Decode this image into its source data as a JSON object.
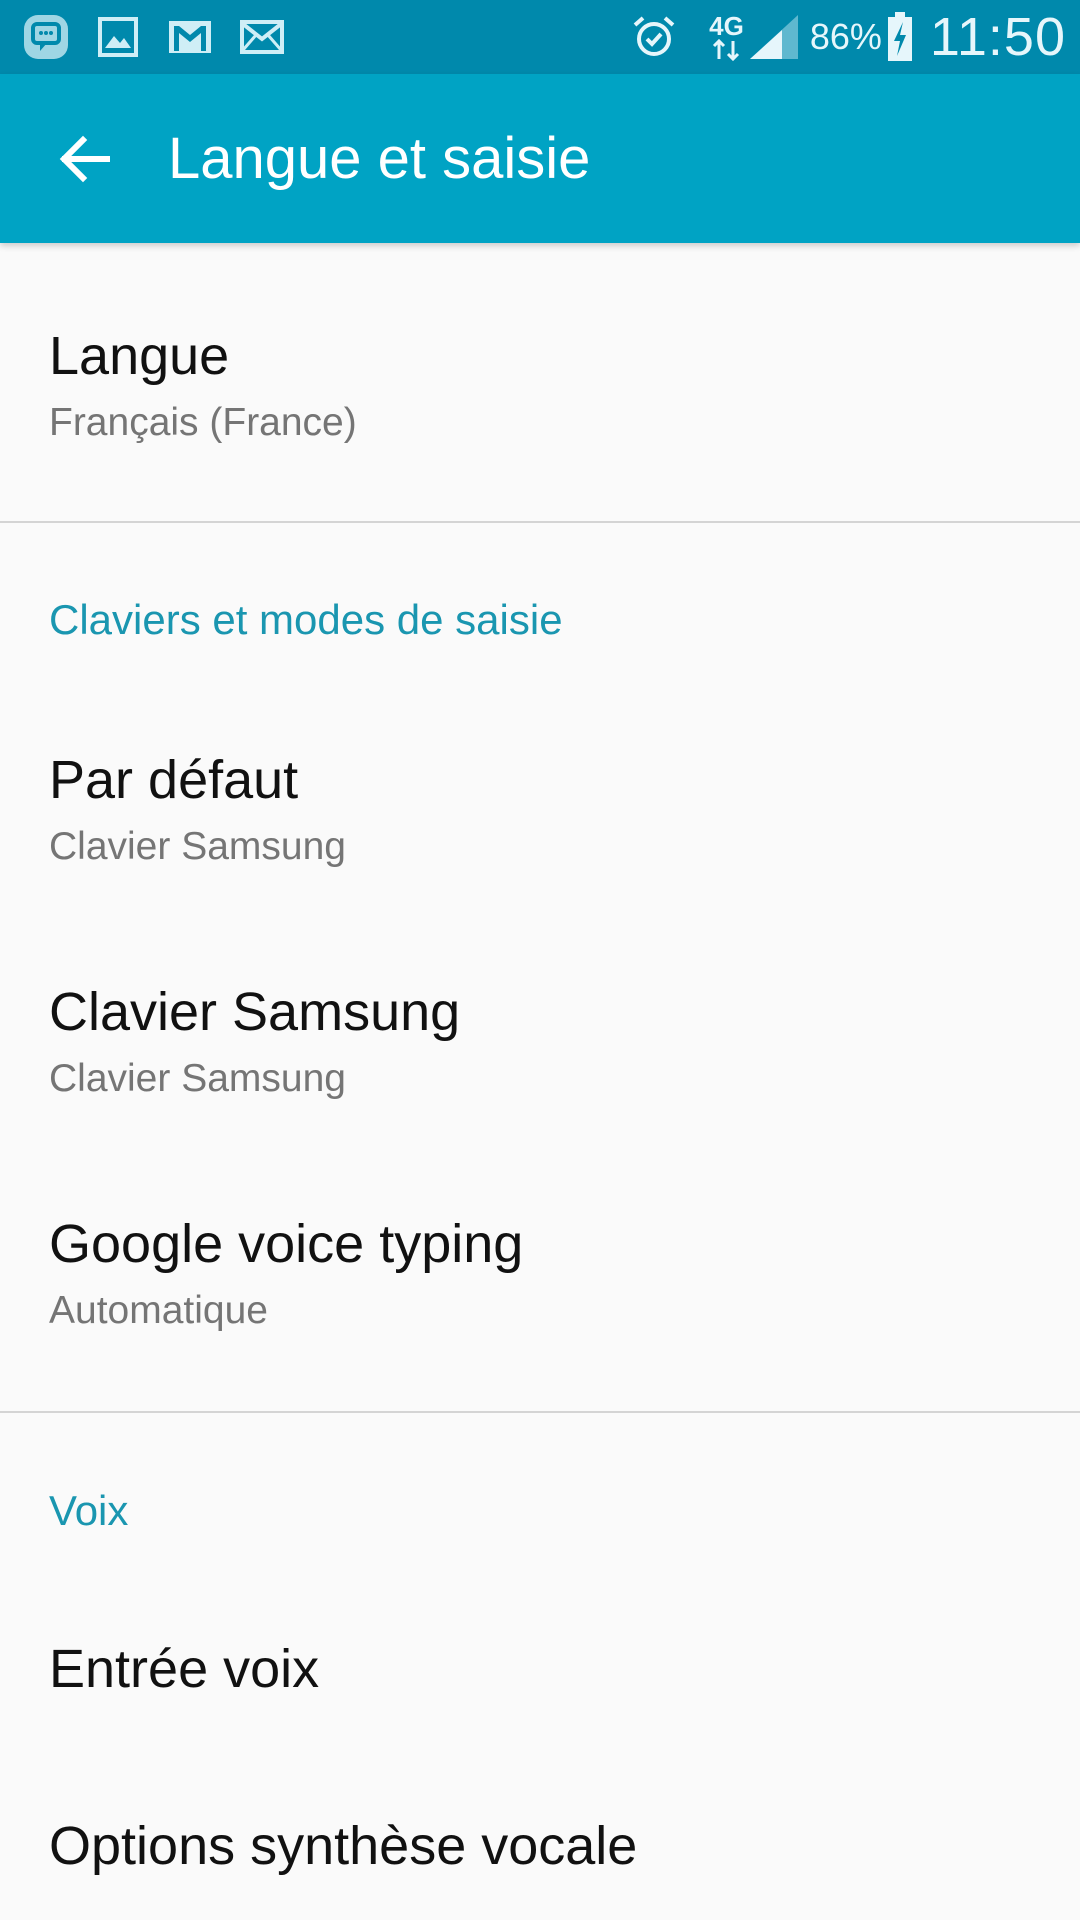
{
  "status_bar": {
    "notification_icons": [
      "chat-icon",
      "image-icon",
      "gmail-icon",
      "email-icon"
    ],
    "system_icons": [
      "alarm-icon",
      "4g-data-icon",
      "signal-icon",
      "battery-charging-icon"
    ],
    "network_type": "4G",
    "battery_percent": "86%",
    "time": "11:50"
  },
  "app_bar": {
    "title": "Langue et saisie",
    "back_icon": "arrow-back-icon"
  },
  "sections": {
    "language": {
      "title": "Langue",
      "value": "Français (France)"
    },
    "keyboards": {
      "header": "Claviers et modes de saisie",
      "items": [
        {
          "title": "Par défaut",
          "value": "Clavier Samsung"
        },
        {
          "title": "Clavier Samsung",
          "value": "Clavier Samsung"
        },
        {
          "title": "Google voice typing",
          "value": "Automatique"
        }
      ]
    },
    "voice": {
      "header": "Voix",
      "items": [
        {
          "title": "Entrée voix"
        },
        {
          "title": "Options synthèse vocale"
        }
      ]
    }
  },
  "colors": {
    "status_bar": "#0089ac",
    "app_bar": "#00a3c4",
    "section_header": "#1a96b0",
    "background": "#fafafa"
  }
}
